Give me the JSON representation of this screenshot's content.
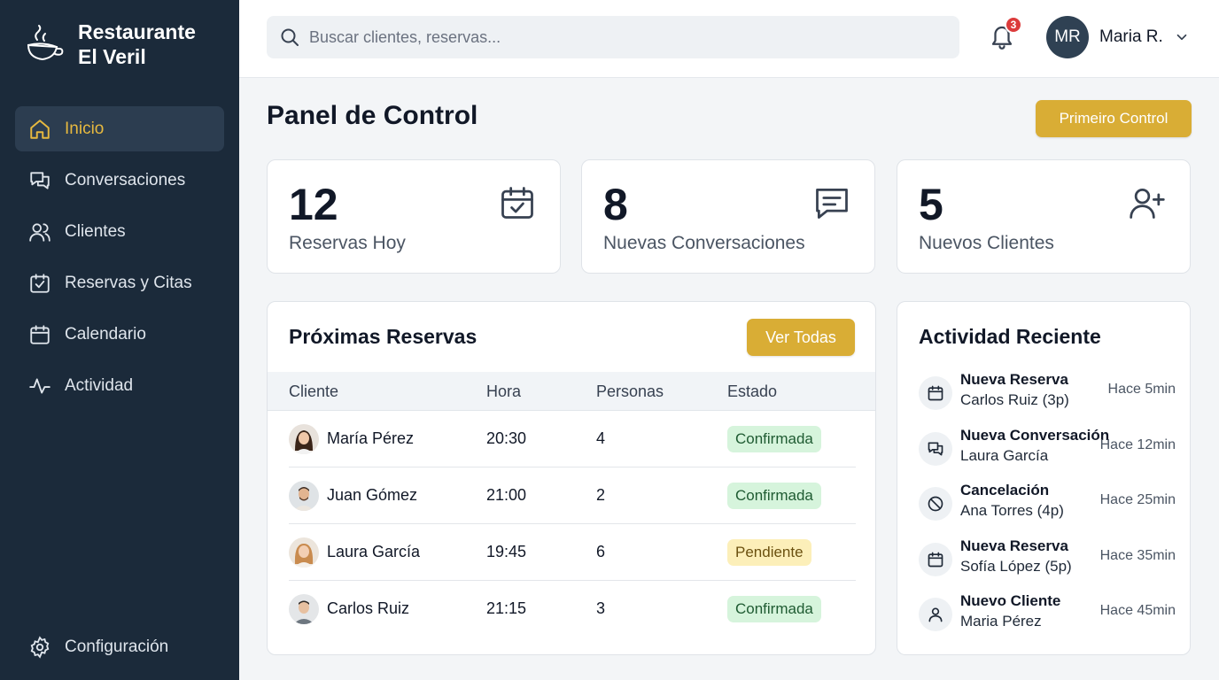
{
  "brand": {
    "line1": "Restaurante",
    "line2": "El Veril"
  },
  "nav": [
    {
      "label": "Inicio",
      "icon": "home-icon",
      "active": true
    },
    {
      "label": "Conversaciones",
      "icon": "chat-icon"
    },
    {
      "label": "Clientes",
      "icon": "users-icon"
    },
    {
      "label": "Reservas y Citas",
      "icon": "calendar-check-icon"
    },
    {
      "label": "Calendario",
      "icon": "calendar-icon"
    },
    {
      "label": "Actividad",
      "icon": "activity-icon"
    }
  ],
  "settings": {
    "label": "Configuración",
    "icon": "gear-icon"
  },
  "search": {
    "placeholder": "Buscar clientes, reservas..."
  },
  "notifications": {
    "count": "3"
  },
  "user": {
    "initials": "MR",
    "name": "Maria R."
  },
  "page": {
    "title": "Panel de Control",
    "primary_button": "Primeiro Control"
  },
  "stats": [
    {
      "value": "12",
      "label": "Reservas Hoy",
      "icon": "calendar-check-icon"
    },
    {
      "value": "8",
      "label": "Nuevas Conversaciones",
      "icon": "message-icon"
    },
    {
      "value": "5",
      "label": "Nuevos Clientes",
      "icon": "user-plus-icon"
    }
  ],
  "reservations": {
    "title": "Próximas Reservas",
    "view_all": "Ver Todas",
    "columns": [
      "Cliente",
      "Hora",
      "Personas",
      "Estado"
    ],
    "rows": [
      {
        "name": "María Pérez",
        "time": "20:30",
        "people": "4",
        "status": "Confirmada",
        "status_type": "ok"
      },
      {
        "name": "Juan Gómez",
        "time": "21:00",
        "people": "2",
        "status": "Confirmada",
        "status_type": "ok"
      },
      {
        "name": "Laura García",
        "time": "19:45",
        "people": "6",
        "status": "Pendiente",
        "status_type": "pend"
      },
      {
        "name": "Carlos Ruiz",
        "time": "21:15",
        "people": "3",
        "status": "Confirmada",
        "status_type": "ok"
      }
    ]
  },
  "activity": {
    "title": "Actividad Reciente",
    "items": [
      {
        "title": "Nueva Reserva",
        "detail": "Carlos Ruiz (3p)",
        "time": "Hace 5min",
        "icon": "calendar-icon"
      },
      {
        "title": "Nueva Conversación",
        "detail": "Laura García",
        "time": "Hace 12min",
        "icon": "chat-icon"
      },
      {
        "title": "Cancelación",
        "detail": "Ana Torres (4p)",
        "time": "Hace 25min",
        "icon": "cancel-icon"
      },
      {
        "title": "Nueva Reserva",
        "detail": "Sofía López (5p)",
        "time": "Hace 35min",
        "icon": "calendar-icon"
      },
      {
        "title": "Nuevo Cliente",
        "detail": "Maria Pérez",
        "time": "Hace 45min",
        "icon": "user-icon"
      }
    ]
  },
  "colors": {
    "sidebar": "#1b2a3a",
    "accent": "#d9ad35",
    "active_nav": "#e7b93f",
    "confirmed_bg": "#d6f4dc",
    "pending_bg": "#fcefb9"
  }
}
